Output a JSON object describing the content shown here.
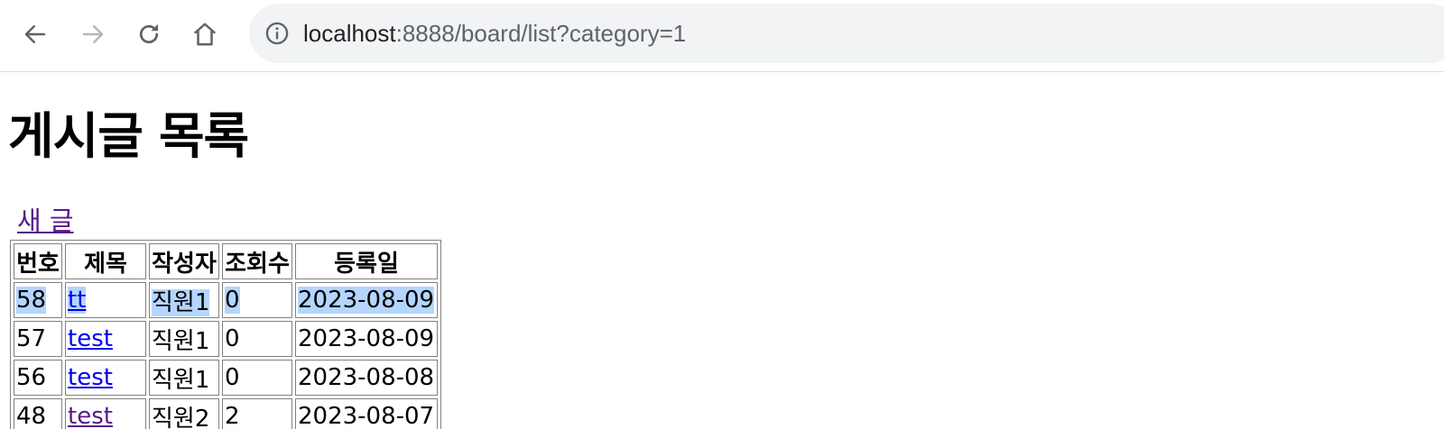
{
  "browser": {
    "url_host": "localhost",
    "url_path": ":8888/board/list?category=1",
    "icons": {
      "back": "arrow-left-icon",
      "forward": "arrow-right-icon",
      "reload": "reload-icon",
      "home": "home-icon",
      "site_info": "info-icon"
    }
  },
  "page": {
    "title": "게시글 목록",
    "new_post_label": "새 글"
  },
  "table": {
    "headers": {
      "no": "번호",
      "title": "제목",
      "writer": "작성자",
      "hits": "조회수",
      "date": "등록일"
    },
    "rows": [
      {
        "no": "58",
        "title": "tt",
        "writer": "직원1",
        "hits": "0",
        "date": "2023-08-09",
        "selected": true
      },
      {
        "no": "57",
        "title": "test",
        "writer": "직원1",
        "hits": "0",
        "date": "2023-08-09"
      },
      {
        "no": "56",
        "title": "test",
        "writer": "직원1",
        "hits": "0",
        "date": "2023-08-08"
      },
      {
        "no": "48",
        "title": "test",
        "writer": "직원2",
        "hits": "2",
        "date": "2023-08-07",
        "visited": true
      }
    ]
  },
  "colors": {
    "link": "#0000ee",
    "visited_link": "#551a8b",
    "selection": "#b4d5fe",
    "omnibox_bg": "#f1f3f4"
  }
}
